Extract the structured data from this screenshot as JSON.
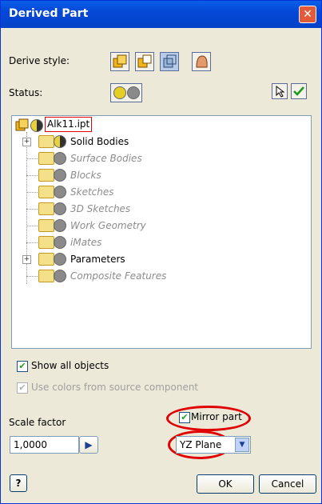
{
  "title": "Derived Part",
  "derive_style_label": "Derive style:",
  "status_label": "Status:",
  "tree": {
    "root": "Alk11.ipt",
    "items": [
      {
        "label": "Solid Bodies",
        "enabled": true,
        "expandable": true
      },
      {
        "label": "Surface Bodies",
        "enabled": false,
        "expandable": false
      },
      {
        "label": "Blocks",
        "enabled": false,
        "expandable": false
      },
      {
        "label": "Sketches",
        "enabled": false,
        "expandable": false
      },
      {
        "label": "3D Sketches",
        "enabled": false,
        "expandable": false
      },
      {
        "label": "Work Geometry",
        "enabled": false,
        "expandable": false
      },
      {
        "label": "iMates",
        "enabled": false,
        "expandable": false
      },
      {
        "label": "Parameters",
        "enabled": true,
        "expandable": true
      },
      {
        "label": "Composite Features",
        "enabled": false,
        "expandable": false
      }
    ]
  },
  "show_all_objects": {
    "label": "Show all objects",
    "checked": true
  },
  "use_colors": {
    "label": "Use colors from source component",
    "checked": true,
    "enabled": false
  },
  "scale_factor": {
    "label": "Scale factor",
    "value": "1,0000"
  },
  "mirror_part": {
    "label": "Mirror part",
    "checked": true
  },
  "plane": {
    "value": "YZ Plane"
  },
  "buttons": {
    "ok": "OK",
    "cancel": "Cancel",
    "help": "?"
  },
  "colors": {
    "title_bar": "#0548d6",
    "highlight": "#e00000",
    "dialog_bg": "#ece9d8"
  }
}
